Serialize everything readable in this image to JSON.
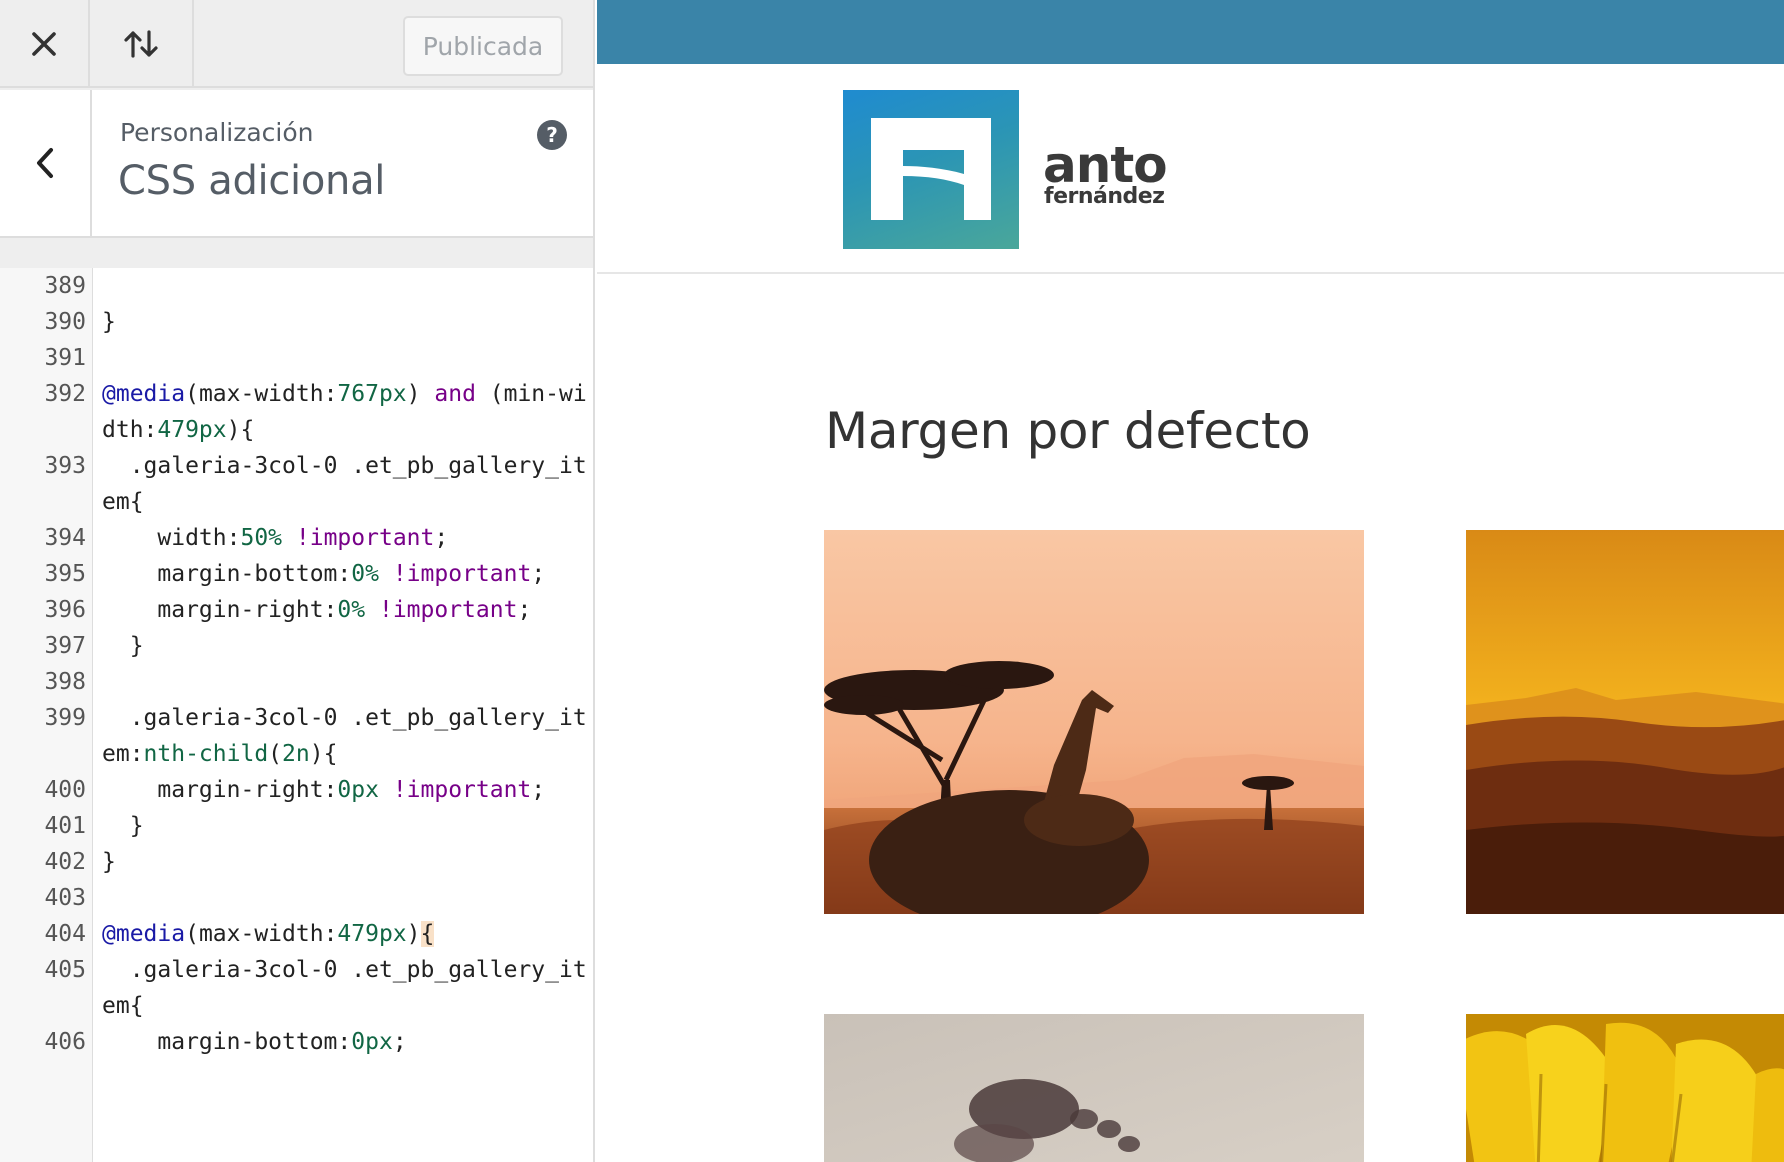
{
  "toolbar": {
    "close_icon": "close-icon",
    "sort_icon": "sort-arrows-icon",
    "publish_label": "Publicada"
  },
  "section": {
    "back_icon": "chevron-left-icon",
    "breadcrumb": "Personalización",
    "title": "CSS adicional",
    "help_icon": "help-icon",
    "help_glyph": "?"
  },
  "editor": {
    "lines": [
      {
        "n": "389",
        "t": [
          ""
        ]
      },
      {
        "n": "390",
        "t": [
          "}"
        ]
      },
      {
        "n": "391",
        "t": [
          ""
        ]
      },
      {
        "n": "392",
        "t": [
          "@media",
          "(max-width:",
          "767px",
          ") ",
          "and",
          " (min-width:",
          "479px",
          "){"
        ]
      },
      {
        "n": "393",
        "t": [
          "  .galeria-3col-0 .et_pb_gallery_item{"
        ]
      },
      {
        "n": "394",
        "t": [
          "    width:",
          "50%",
          " ",
          "!important",
          ";"
        ]
      },
      {
        "n": "395",
        "t": [
          "    margin-bottom:",
          "0%",
          " ",
          "!important",
          ";"
        ]
      },
      {
        "n": "396",
        "t": [
          "    margin-right:",
          "0%",
          " ",
          "!important",
          ";"
        ]
      },
      {
        "n": "397",
        "t": [
          "  }"
        ]
      },
      {
        "n": "398",
        "t": [
          ""
        ]
      },
      {
        "n": "399",
        "t": [
          "  .galeria-3col-0 .et_pb_gallery_item:",
          "nth-child",
          "(",
          "2n",
          "){"
        ]
      },
      {
        "n": "400",
        "t": [
          "    margin-right:",
          "0px",
          " ",
          "!important",
          ";"
        ]
      },
      {
        "n": "401",
        "t": [
          "  }"
        ]
      },
      {
        "n": "402",
        "t": [
          "}"
        ]
      },
      {
        "n": "403",
        "t": [
          ""
        ]
      },
      {
        "n": "404",
        "t": [
          "@media",
          "(max-width:",
          "479px",
          ")",
          "{"
        ]
      },
      {
        "n": "405",
        "t": [
          "  .galeria-3col-0 .et_pb_gallery_item{"
        ]
      },
      {
        "n": "406",
        "t": [
          "    margin-bottom:",
          "0px",
          ";"
        ]
      }
    ]
  },
  "preview": {
    "logo_line1": "anto",
    "logo_line2": "fernández",
    "heading": "Margen por defecto",
    "colors": {
      "topbar": "#3a84a8",
      "logo_blue": "#1f8bd0",
      "logo_green": "#4aa79a"
    }
  }
}
